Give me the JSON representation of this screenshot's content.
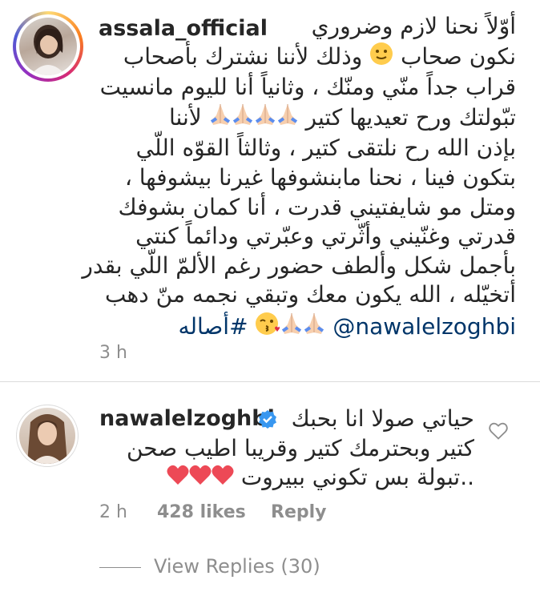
{
  "comment1": {
    "username": "assala_official",
    "lines": [
      "أوّلاً نحنا لازم وضروري",
      "وذلك لأننا نشترك بأصحاب",
      "قراب جداً منّي ومنّك ، وثانياً أنا لليوم مانسيت",
      "تبّولتك ورح تعيديها كتير",
      "بإذن الله رح نلتقى كتير ، وثالثاً القوّه اللّي",
      "بتكون فينا ، نحنا مابنشوفها غيرنا بيشوفها ،",
      "ومتل مو شايفتيني قدرت ، أنا كمان بشوفك",
      "قدرتي وغنّيني وأثّرتي وعبّرتي ودائماً كنتي",
      "بأجمل شكل وألطف حضور رغم الألمّ اللّي بقدر",
      "أتخيّله ، الله يكون معك وتبقي نجمه منّ دهب"
    ],
    "line2_end": "نكون صحاب",
    "line4_end": "لأننا",
    "mention": "@nawalelzoghbi",
    "hashtag": "#أصاله",
    "time": "3 h"
  },
  "comment2": {
    "username": "nawalelzoghbi",
    "verified": true,
    "lines": [
      "حياتي صولا انا بحبك",
      "كتير وبحترمك كتير وقريبا اطيب صحن",
      "..تبولة بس تكوني ببيروت"
    ],
    "time": "2 h",
    "likes": "428 likes",
    "reply": "Reply",
    "view_replies": "View Replies (30)"
  },
  "colors": {
    "text": "#262626",
    "secondary": "#8e8e8e",
    "link": "#003569",
    "heart": "#ed4956",
    "verified": "#3897f0"
  },
  "icons": [
    "folded-hands-emoji",
    "smiling-face-emoji",
    "kiss-emoji",
    "verified-badge-icon",
    "heart-emoji",
    "like-heart-icon"
  ]
}
